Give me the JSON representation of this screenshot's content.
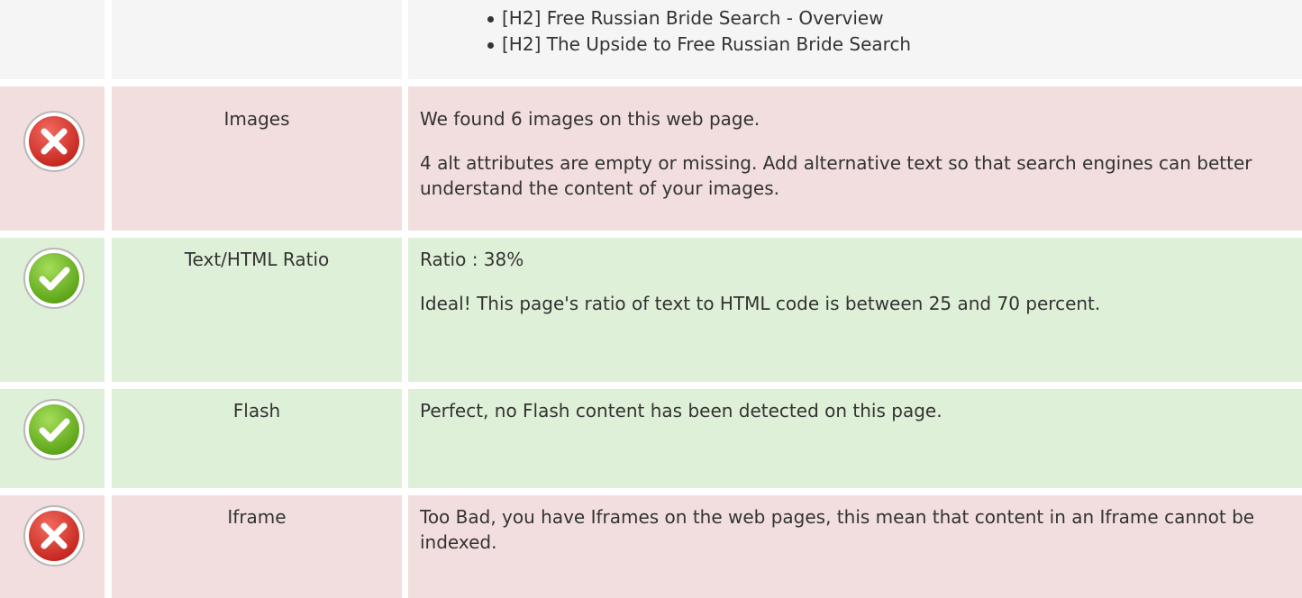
{
  "headings_row": {
    "items": [
      "[H2] Free Russian Bride Search - Overview",
      "[H2] The Upside to Free Russian Bride Search"
    ]
  },
  "checks": [
    {
      "status": "error",
      "icon": "cross-icon",
      "name": "Images",
      "paragraphs": [
        "We found 6 images on this web page.",
        "4 alt attributes are empty or missing. Add alternative text so that search engines can better understand the content of your images."
      ]
    },
    {
      "status": "success",
      "icon": "check-icon",
      "name": "Text/HTML Ratio",
      "paragraphs": [
        "Ratio : 38%",
        "Ideal! This page's ratio of text to HTML code is between 25 and 70 percent."
      ]
    },
    {
      "status": "success",
      "icon": "check-icon",
      "name": "Flash",
      "paragraphs": [
        "Perfect, no Flash content has been detected on this page."
      ]
    },
    {
      "status": "error",
      "icon": "cross-icon",
      "name": "Iframe",
      "paragraphs": [
        "Too Bad, you have Iframes on the web pages, this mean that content in an Iframe cannot be indexed."
      ]
    }
  ],
  "colors": {
    "error_background": "#f2dede",
    "success_background": "#dff0d8",
    "neutral_background": "#f5f5f5",
    "error_icon": "#d9302a",
    "success_icon": "#6cb41f"
  }
}
